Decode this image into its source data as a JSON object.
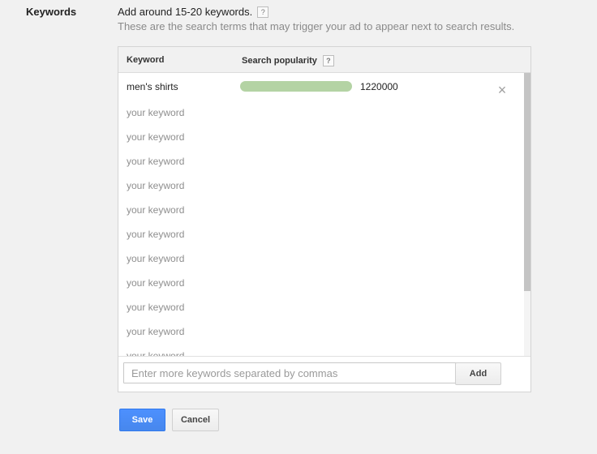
{
  "section": {
    "label": "Keywords"
  },
  "instructions": {
    "main": "Add around 15-20 keywords.",
    "help": "?",
    "sub": "These are the search terms that may trigger your ad to appear next to search results."
  },
  "table": {
    "col_keyword": "Keyword",
    "col_popularity": "Search popularity",
    "col_popularity_help": "?",
    "first_row": {
      "keyword": "men's shirts",
      "popularity": "1220000",
      "popularity_fraction": 1.0,
      "bar_color": "#b4d3a4",
      "remove_icon": "×"
    },
    "placeholders": [
      "your keyword",
      "your keyword",
      "your keyword",
      "your keyword",
      "your keyword",
      "your keyword",
      "your keyword",
      "your keyword",
      "your keyword",
      "your keyword",
      "your keyword"
    ]
  },
  "footer": {
    "input_placeholder": "Enter more keywords separated by commas",
    "input_value": "",
    "add_label": "Add"
  },
  "actions": {
    "save_label": "Save",
    "cancel_label": "Cancel",
    "save_color": "#4d90fe"
  }
}
